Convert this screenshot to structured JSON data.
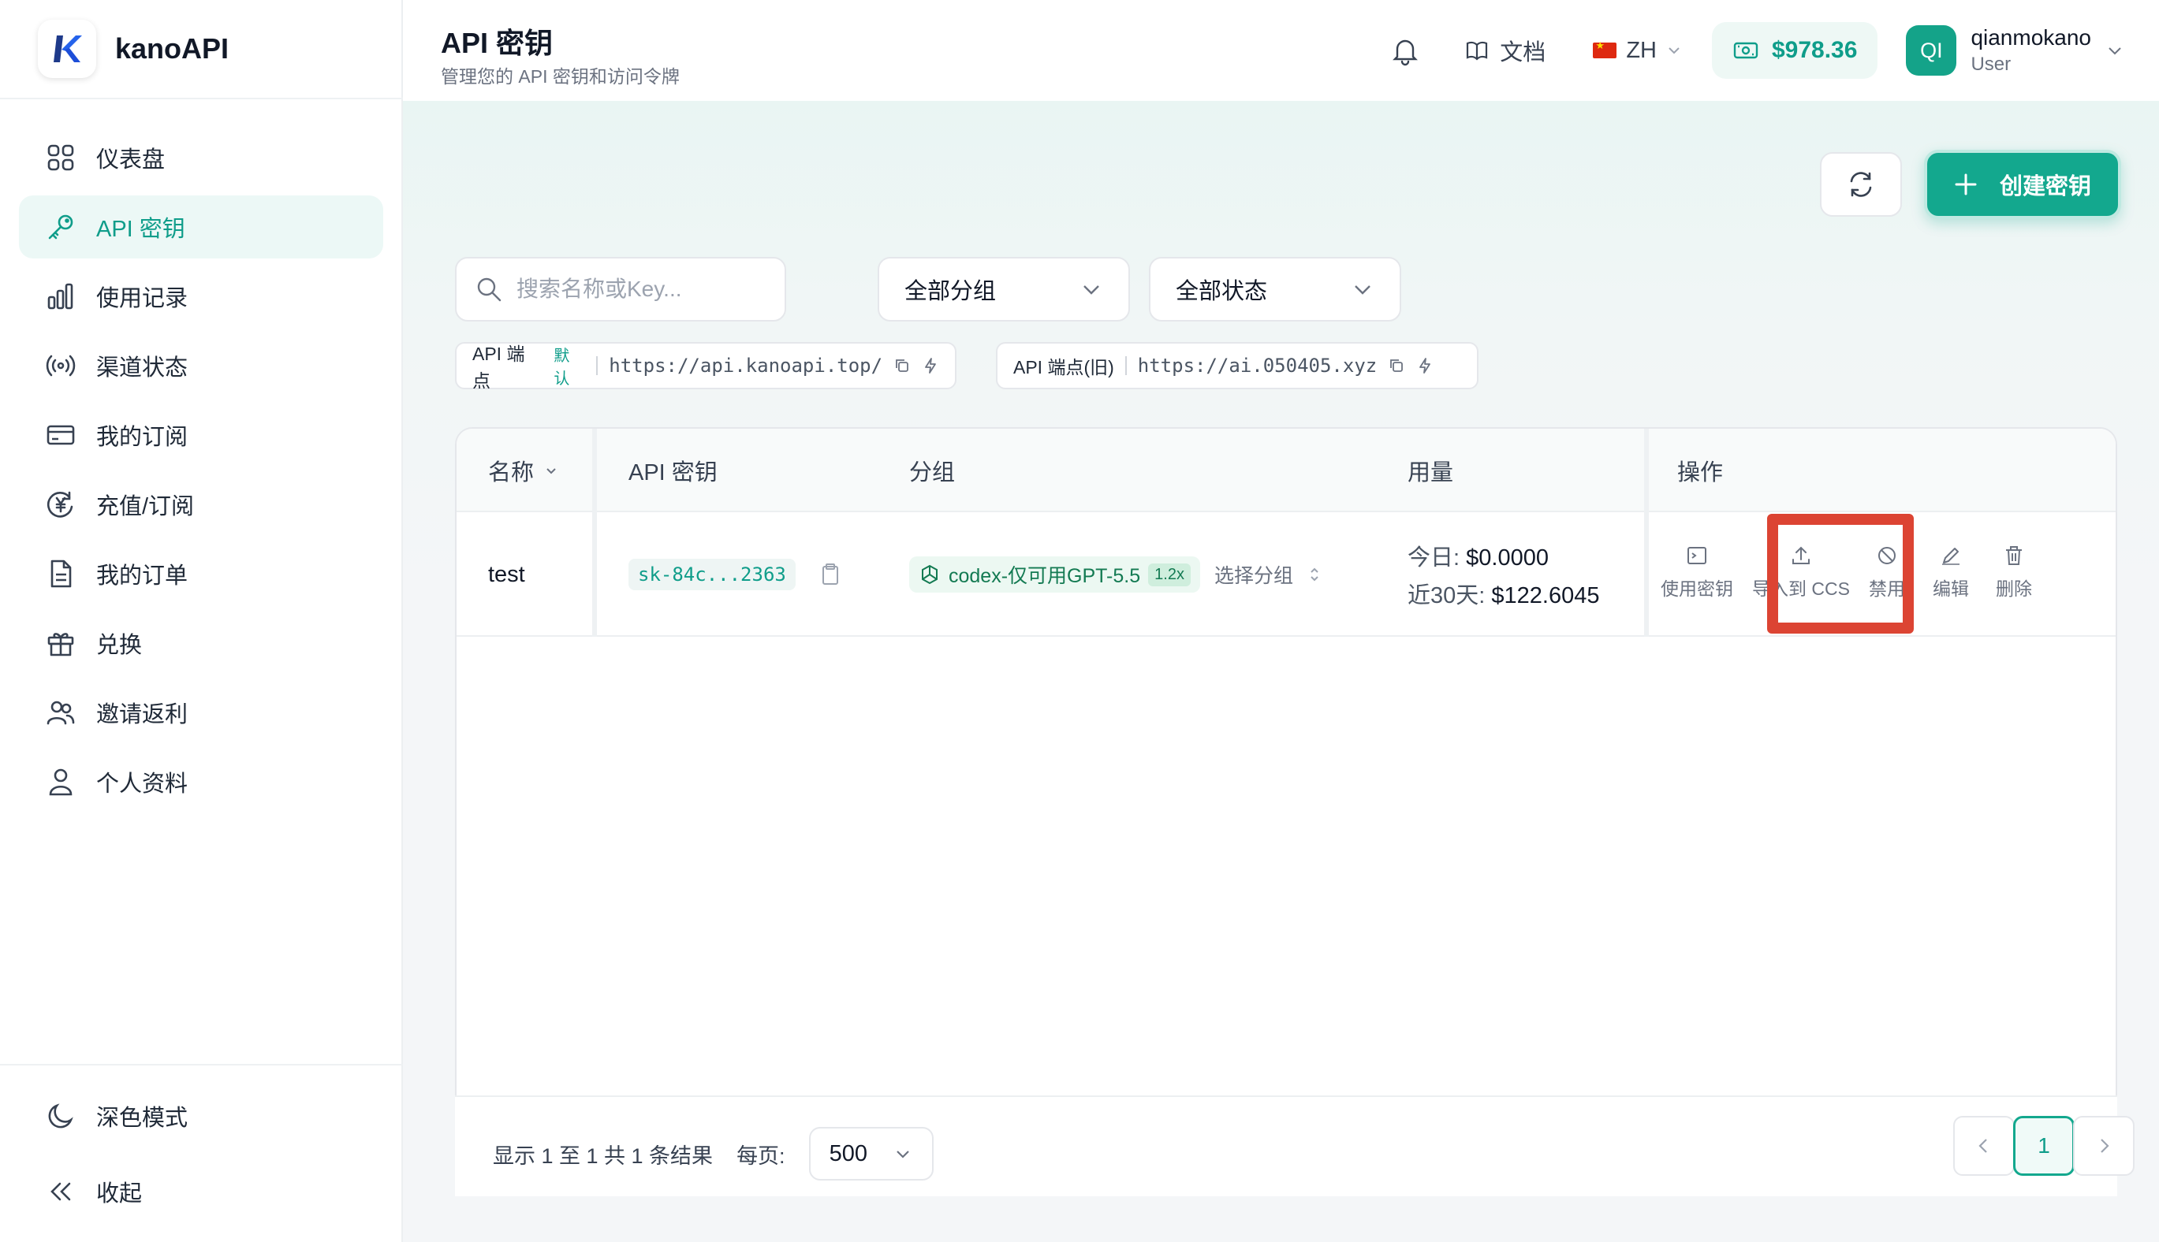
{
  "brand": {
    "name": "kanoAPI",
    "logo_letter": "K"
  },
  "sidebar": {
    "items": [
      {
        "label": "仪表盘",
        "icon": "grid-icon"
      },
      {
        "label": "API 密钥",
        "icon": "key-icon",
        "active": true
      },
      {
        "label": "使用记录",
        "icon": "bar-chart-icon"
      },
      {
        "label": "渠道状态",
        "icon": "broadcast-icon"
      },
      {
        "label": "我的订阅",
        "icon": "credit-card-icon"
      },
      {
        "label": "充值/订阅",
        "icon": "yen-coin-icon"
      },
      {
        "label": "我的订单",
        "icon": "document-icon"
      },
      {
        "label": "兑换",
        "icon": "gift-icon"
      },
      {
        "label": "邀请返利",
        "icon": "users-icon"
      },
      {
        "label": "个人资料",
        "icon": "user-icon"
      }
    ],
    "bottom": [
      {
        "label": "深色模式",
        "icon": "moon-icon"
      },
      {
        "label": "收起",
        "icon": "double-chevron-left-icon"
      }
    ]
  },
  "header": {
    "title": "API 密钥",
    "subtitle": "管理您的 API 密钥和访问令牌",
    "docs_label": "文档",
    "lang_label": "ZH",
    "balance": "$978.36",
    "user": {
      "initials": "QI",
      "name": "qianmokano",
      "role": "User"
    }
  },
  "toolbar": {
    "create_label": "创建密钥",
    "search_placeholder": "搜索名称或Key...",
    "group_filter": "全部分组",
    "status_filter": "全部状态"
  },
  "endpoints": [
    {
      "label": "API 端点",
      "tag": "默认",
      "url": "https://api.kanoapi.top/"
    },
    {
      "label": "API 端点(旧)",
      "tag": "",
      "url": "https://ai.050405.xyz"
    }
  ],
  "table": {
    "headers": {
      "name": "名称",
      "key": "API 密钥",
      "group": "分组",
      "usage": "用量",
      "actions": "操作"
    },
    "rows": [
      {
        "name": "test",
        "key": "sk-84c...2363",
        "group": "codex-仅可用GPT-5.5",
        "ratio": "1.2x",
        "select_group": "选择分组",
        "today_label": "今日:",
        "today_value": "$0.0000",
        "month_label": "近30天:",
        "month_value": "$122.6045"
      }
    ],
    "actions": {
      "use": "使用密钥",
      "import_ccs": "导入到 CCS",
      "disable": "禁用",
      "edit": "编辑",
      "delete": "删除"
    },
    "highlight_color": "#dc4433"
  },
  "pagination": {
    "summary": "显示 1 至 1 共 1 条结果",
    "per_page_label": "每页:",
    "per_page_value": "500",
    "current_page": "1"
  },
  "colors": {
    "accent": "#13a88e",
    "accent_dark": "#0f9d8a"
  }
}
